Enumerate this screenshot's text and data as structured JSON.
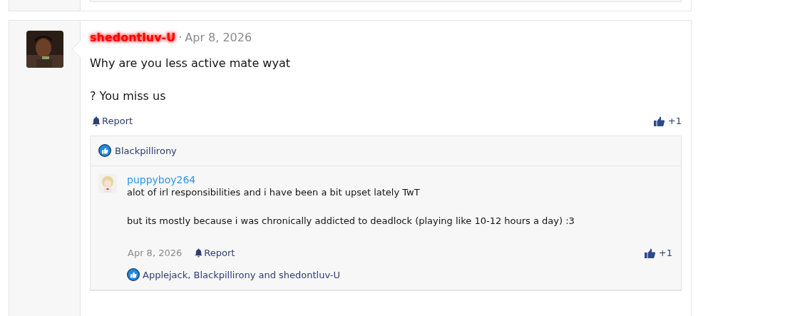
{
  "post": {
    "author": "shedontluv-U",
    "separator": "·",
    "date": "Apr 8, 2026",
    "paragraphs": [
      "Why are you less active mate wyat",
      "? You miss us"
    ],
    "report": "Report",
    "reaction_count": "+1",
    "reactions": "Blackpillirony",
    "replies": [
      {
        "author": "puppyboy264",
        "paragraphs": [
          "alot of irl responsibilities and i have been a bit upset lately TwT",
          "but its mostly because i was chronically addicted to deadlock (playing like 10-12 hours a day) :3"
        ],
        "date": "Apr 8, 2026",
        "report": "Report",
        "reaction_count": "+1",
        "reactions": "Applejack, Blackpillirony and shedontluv-U"
      }
    ]
  }
}
